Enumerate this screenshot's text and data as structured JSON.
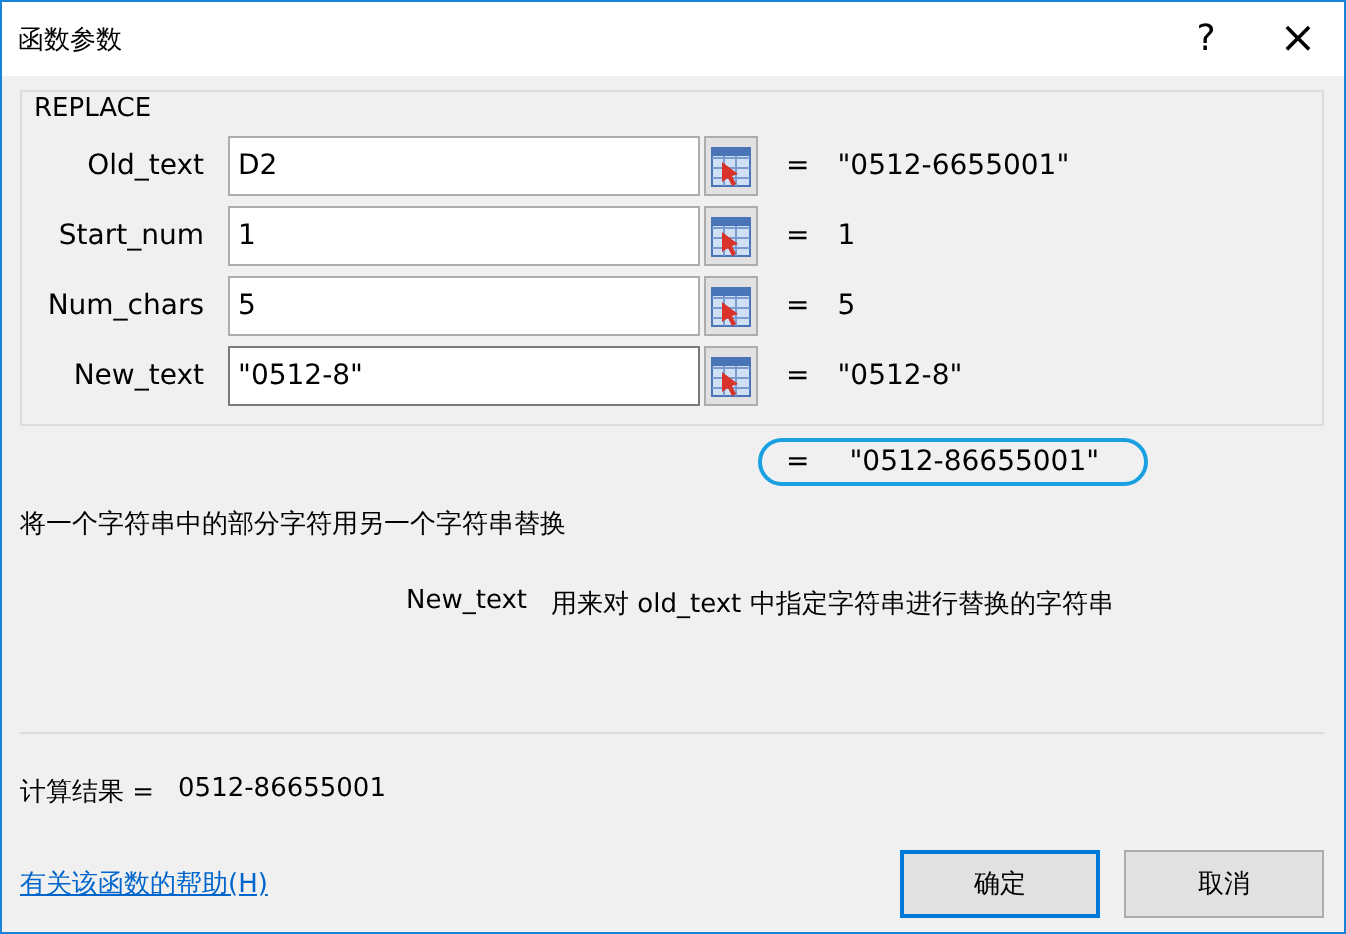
{
  "window": {
    "title": "函数参数",
    "help": "?",
    "close": "×"
  },
  "function_name": "REPLACE",
  "arguments": [
    {
      "label": "Old_text",
      "value": "D2",
      "equals": "=",
      "result": "\"0512-6655001\"",
      "focused": false
    },
    {
      "label": "Start_num",
      "value": "1",
      "equals": "=",
      "result": "1",
      "focused": false
    },
    {
      "label": "Num_chars",
      "value": "5",
      "equals": "=",
      "result": "5",
      "focused": false
    },
    {
      "label": "New_text",
      "value": "\"0512-8\"",
      "equals": "=",
      "result": "\"0512-8\"",
      "focused": true
    }
  ],
  "formula_result": {
    "equals": "=",
    "text": "\"0512-86655001\"",
    "circled": true
  },
  "description": "将一个字符串中的部分字符用另一个字符串替换",
  "argument_help": {
    "name": "New_text",
    "text": "用来对 old_text 中指定字符串进行替换的字符串"
  },
  "calc_result": {
    "label": "计算结果 =",
    "value": "0512-86655001"
  },
  "help_link": "有关该函数的帮助(H)",
  "buttons": [
    {
      "label": "确定",
      "default": true
    },
    {
      "label": "取消",
      "default": false
    }
  ]
}
